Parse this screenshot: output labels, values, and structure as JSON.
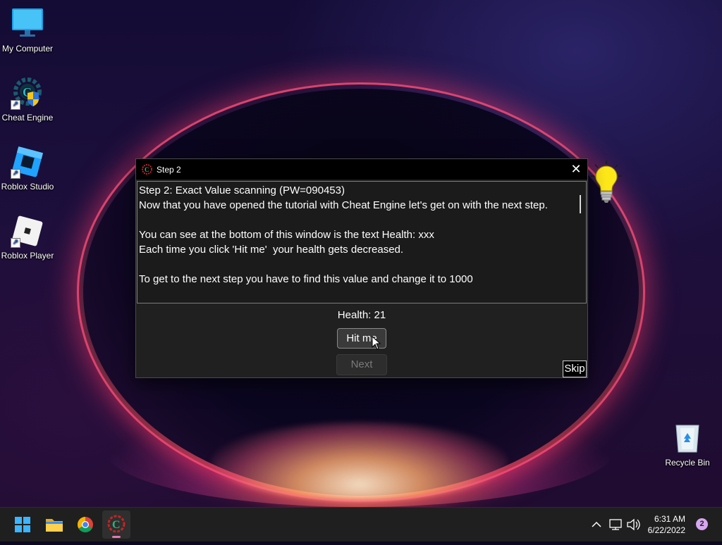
{
  "desktop": {
    "icons": [
      {
        "label": "My Computer"
      },
      {
        "label": "Cheat Engine"
      },
      {
        "label": "Roblox Studio"
      },
      {
        "label": "Roblox Player"
      },
      {
        "label": "Recycle Bin"
      }
    ]
  },
  "dialog": {
    "title": "Step 2",
    "lines": [
      "Step 2: Exact Value scanning (PW=090453)",
      "Now that you have opened the tutorial with Cheat Engine let's get on with the next step.",
      "",
      "You can see at the bottom of this window is the text Health: xxx",
      "Each time you click 'Hit me'  your health gets decreased.",
      "",
      "To get to the next step you have to find this value and change it to 1000"
    ],
    "health_text": "Health: 21",
    "hit_label": "Hit me",
    "next_label": "Next",
    "skip_label": "Skip"
  },
  "taskbar": {
    "time": "6:31 AM",
    "date": "6/22/2022",
    "notification_count": "2"
  },
  "colors": {
    "taskbar_bg": "#1f1f1f",
    "dialog_bg": "#202020",
    "titlebar_bg": "#000000",
    "accent_indicator": "#e27ab0"
  },
  "icons": [
    "computer-icon",
    "cheat-engine-icon",
    "roblox-studio-icon",
    "roblox-player-icon",
    "recycle-bin-icon",
    "lightbulb-icon",
    "windows-start-icon",
    "file-explorer-icon",
    "chrome-icon",
    "close-icon",
    "mouse-cursor-icon",
    "chevron-up-icon",
    "network-icon",
    "volume-icon"
  ]
}
